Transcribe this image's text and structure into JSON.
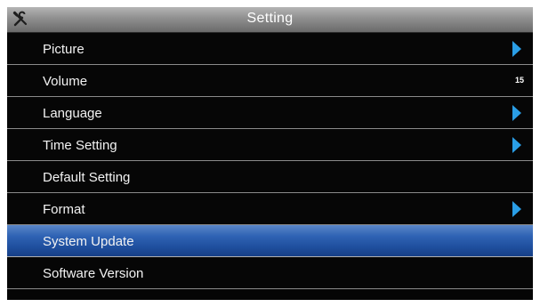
{
  "title": "Setting",
  "title_icon": "tools-icon",
  "colors": {
    "title_bar": "#9a9a9a",
    "background": "#050505",
    "selected": "#2f63b4",
    "arrow": "#2a9ee6",
    "divider": "#8a8a8a"
  },
  "items": [
    {
      "label": "Picture",
      "has_arrow": true,
      "value": ""
    },
    {
      "label": "Volume",
      "has_arrow": false,
      "value": "15"
    },
    {
      "label": "Language",
      "has_arrow": true,
      "value": ""
    },
    {
      "label": "Time Setting",
      "has_arrow": true,
      "value": ""
    },
    {
      "label": "Default Setting",
      "has_arrow": false,
      "value": ""
    },
    {
      "label": "Format",
      "has_arrow": true,
      "value": ""
    },
    {
      "label": "System Update",
      "has_arrow": false,
      "value": "",
      "selected": true
    },
    {
      "label": "Software Version",
      "has_arrow": false,
      "value": ""
    }
  ]
}
